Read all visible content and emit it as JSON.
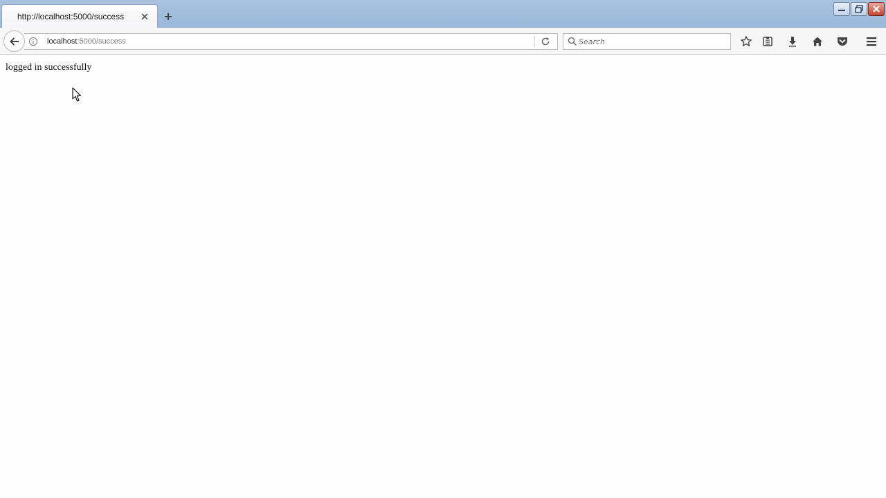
{
  "tab": {
    "title": "http://localhost:5000/success",
    "close_icon": "close-icon",
    "new_tab_icon": "plus-icon"
  },
  "window_controls": {
    "minimize_icon": "minimize-icon",
    "restore_icon": "restore-icon",
    "close_icon": "close-icon"
  },
  "navbar": {
    "back_icon": "arrow-left-icon",
    "info_icon": "info-icon",
    "url_host": "localhost",
    "url_rest": ":5000/success",
    "reload_icon": "reload-icon",
    "search_placeholder": "Search",
    "search_value": "",
    "toolbar_icons": [
      "star-icon",
      "reading-list-icon",
      "download-icon",
      "home-icon",
      "pocket-icon",
      "hamburger-menu-icon"
    ]
  },
  "page": {
    "message": "logged in successfully"
  },
  "colors": {
    "tabstrip": "#9ab8d9",
    "window_close": "#c8452f",
    "background": "#fefefe"
  }
}
